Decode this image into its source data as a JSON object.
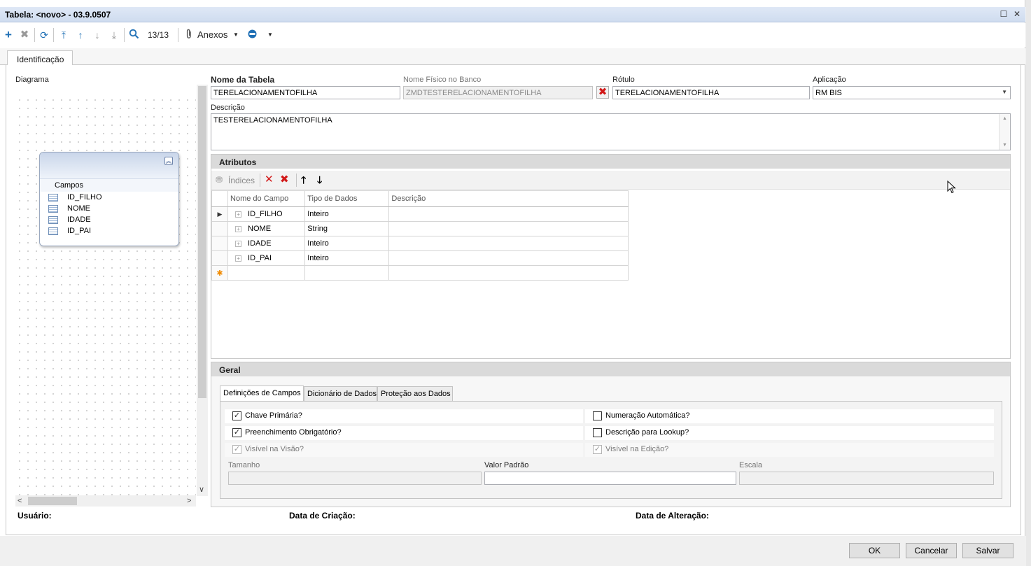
{
  "window": {
    "title": "Tabela: <novo> - 03.9.0507"
  },
  "toolbar": {
    "record_counter": "13/13",
    "attachments_label": "Anexos"
  },
  "tabs": {
    "identificacao": "Identificação"
  },
  "diagram": {
    "label": "Diagrama",
    "section_label": "Campos",
    "fields": [
      "ID_FILHO",
      "NOME",
      "IDADE",
      "ID_PAI"
    ]
  },
  "form": {
    "nome_tabela_label": "Nome da Tabela",
    "nome_tabela_value": "TERELACIONAMENTOFILHA",
    "nome_fisico_label": "Nome Físico no Banco",
    "nome_fisico_value": "ZMDTESTERELACIONAMENTOFILHA",
    "rotulo_label": "Rótulo",
    "rotulo_value": "TERELACIONAMENTOFILHA",
    "aplicacao_label": "Aplicação",
    "aplicacao_value": "RM BIS",
    "descricao_label": "Descrição",
    "descricao_value": "TESTERELACIONAMENTOFILHA"
  },
  "atributos": {
    "title": "Atributos",
    "indices_label": "Índices",
    "columns": [
      "Nome do Campo",
      "Tipo de Dados",
      "Descrição"
    ],
    "rows": [
      {
        "nome": "ID_FILHO",
        "tipo": "Inteiro",
        "descricao": ""
      },
      {
        "nome": "NOME",
        "tipo": "String",
        "descricao": ""
      },
      {
        "nome": "IDADE",
        "tipo": "Inteiro",
        "descricao": ""
      },
      {
        "nome": "ID_PAI",
        "tipo": "Inteiro",
        "descricao": ""
      }
    ]
  },
  "geral": {
    "title": "Geral",
    "tabs": [
      "Definições de Campos",
      "Dicionário de Dados",
      "Proteção aos Dados"
    ],
    "checkboxes": {
      "chave_primaria": {
        "label": "Chave Primária?",
        "checked": true
      },
      "preenchimento": {
        "label": "Preenchimento Obrigatório?",
        "checked": true
      },
      "visivel_visao": {
        "label": "Visível na Visão?",
        "checked": true
      },
      "numeracao": {
        "label": "Numeração Automática?",
        "checked": false
      },
      "descricao_lookup": {
        "label": "Descrição para Lookup?",
        "checked": false
      },
      "visivel_edicao": {
        "label": "Visível na Edição?",
        "checked": true
      }
    },
    "tamanho_label": "Tamanho",
    "valor_padrao_label": "Valor Padrão",
    "escala_label": "Escala"
  },
  "status": {
    "usuario_label": "Usuário:",
    "data_criacao_label": "Data de Criação:",
    "data_alteracao_label": "Data de Alteração:"
  },
  "buttons": {
    "ok": "OK",
    "cancelar": "Cancelar",
    "salvar": "Salvar"
  }
}
